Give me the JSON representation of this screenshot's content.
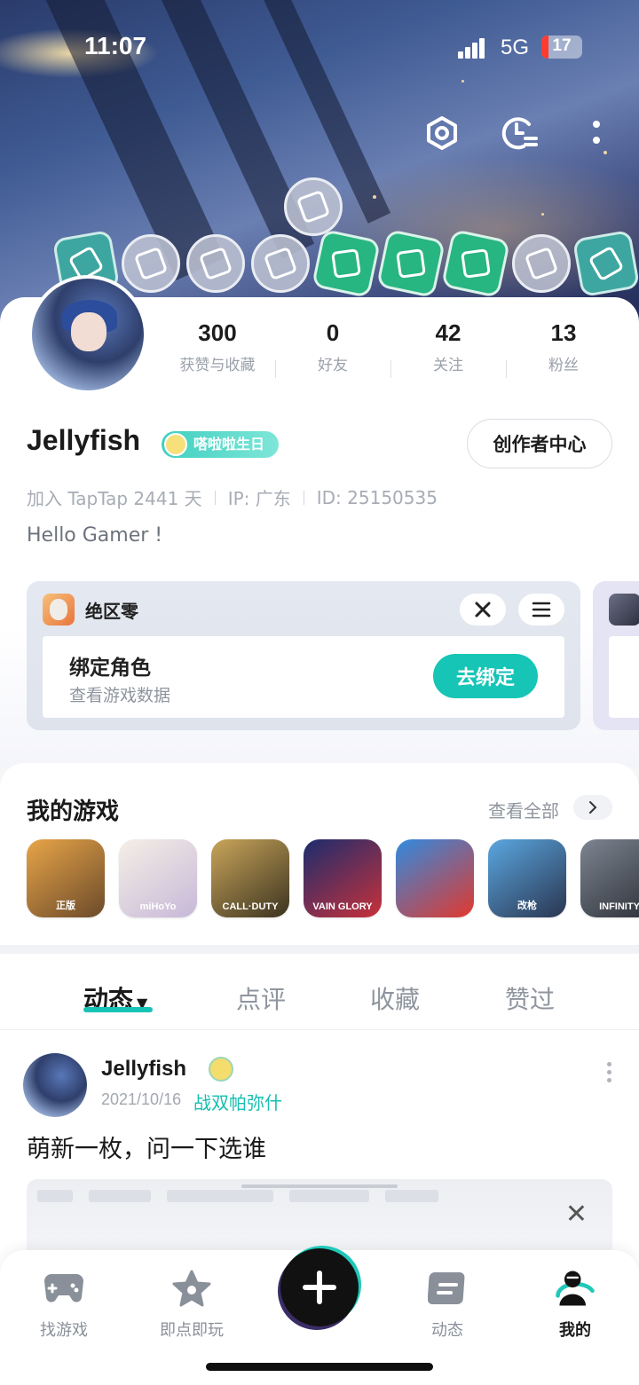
{
  "status_bar": {
    "time": "11:07",
    "network": "5G",
    "battery": "17"
  },
  "header": {
    "icons": [
      "settings-hex-icon",
      "history-clock-icon",
      "more-vertical-icon"
    ]
  },
  "badges": [
    {
      "name": "badge-teal-1",
      "style": "teal"
    },
    {
      "name": "badge-gray-1",
      "style": "gray"
    },
    {
      "name": "badge-gray-2",
      "style": "gray"
    },
    {
      "name": "badge-gray-3",
      "style": "gray"
    },
    {
      "name": "badge-green-1",
      "style": "green"
    },
    {
      "name": "badge-green-2",
      "style": "green"
    },
    {
      "name": "badge-green-3",
      "style": "green"
    },
    {
      "name": "badge-gray-4",
      "style": "gray"
    },
    {
      "name": "badge-teal-2",
      "style": "teal"
    },
    {
      "name": "badge-gray-top",
      "style": "gray"
    }
  ],
  "profile": {
    "stats": [
      {
        "value": "300",
        "label": "获赞与收藏"
      },
      {
        "value": "0",
        "label": "好友"
      },
      {
        "value": "42",
        "label": "关注"
      },
      {
        "value": "13",
        "label": "粉丝"
      }
    ],
    "name": "Jellyfish",
    "title_tag": "嗒啦啦生日",
    "creator_button": "创作者中心",
    "meta": {
      "joined": "加入 TapTap 2441 天",
      "ip": "IP: 广东",
      "id": "ID: 25150535"
    },
    "bio": "Hello Gamer !"
  },
  "bind_card": {
    "game_name": "绝区零",
    "title": "绑定角色",
    "subtitle": "查看游戏数据",
    "button": "去绑定"
  },
  "my_games": {
    "title": "我的游戏",
    "see_all": "查看全部",
    "games": [
      {
        "name": "pubg-game-icon",
        "caption": "正版",
        "colors": [
          "#e8a548",
          "#6b4a2a"
        ]
      },
      {
        "name": "genshin-game-icon",
        "caption": "miHoYo",
        "colors": [
          "#f5efe6",
          "#c7b8d8"
        ]
      },
      {
        "name": "call-of-duty-game-icon",
        "caption": "CALL·DUTY",
        "colors": [
          "#c9a55a",
          "#3b3320"
        ]
      },
      {
        "name": "vainglory-game-icon",
        "caption": "VAIN GLORY",
        "colors": [
          "#1b2c6e",
          "#c8313a"
        ]
      },
      {
        "name": "clash-royale-game-icon",
        "caption": "",
        "colors": [
          "#2f8be0",
          "#e2382e"
        ]
      },
      {
        "name": "cf-game-icon",
        "caption": "改枪",
        "colors": [
          "#5aa7e0",
          "#2a3550"
        ]
      },
      {
        "name": "crisis-game-icon",
        "caption": "INFINITY",
        "colors": [
          "#7d8591",
          "#2b2f36"
        ]
      }
    ]
  },
  "tabs": [
    "动态",
    "点评",
    "收藏",
    "赞过"
  ],
  "post": {
    "author": "Jellyfish",
    "date": "2021/10/16",
    "game": "战双帕弥什",
    "text": "萌新一枚，问一下选谁"
  },
  "bottom_nav": [
    {
      "label": "找游戏",
      "icon": "gamepad-icon"
    },
    {
      "label": "即点即玩",
      "icon": "star-icon"
    },
    {
      "label": "动态",
      "icon": "feed-icon"
    },
    {
      "label": "我的",
      "icon": "profile-icon"
    }
  ],
  "colors": {
    "accent": "#16c5b6",
    "text": "#1a1a1a",
    "muted": "#8f959e"
  }
}
